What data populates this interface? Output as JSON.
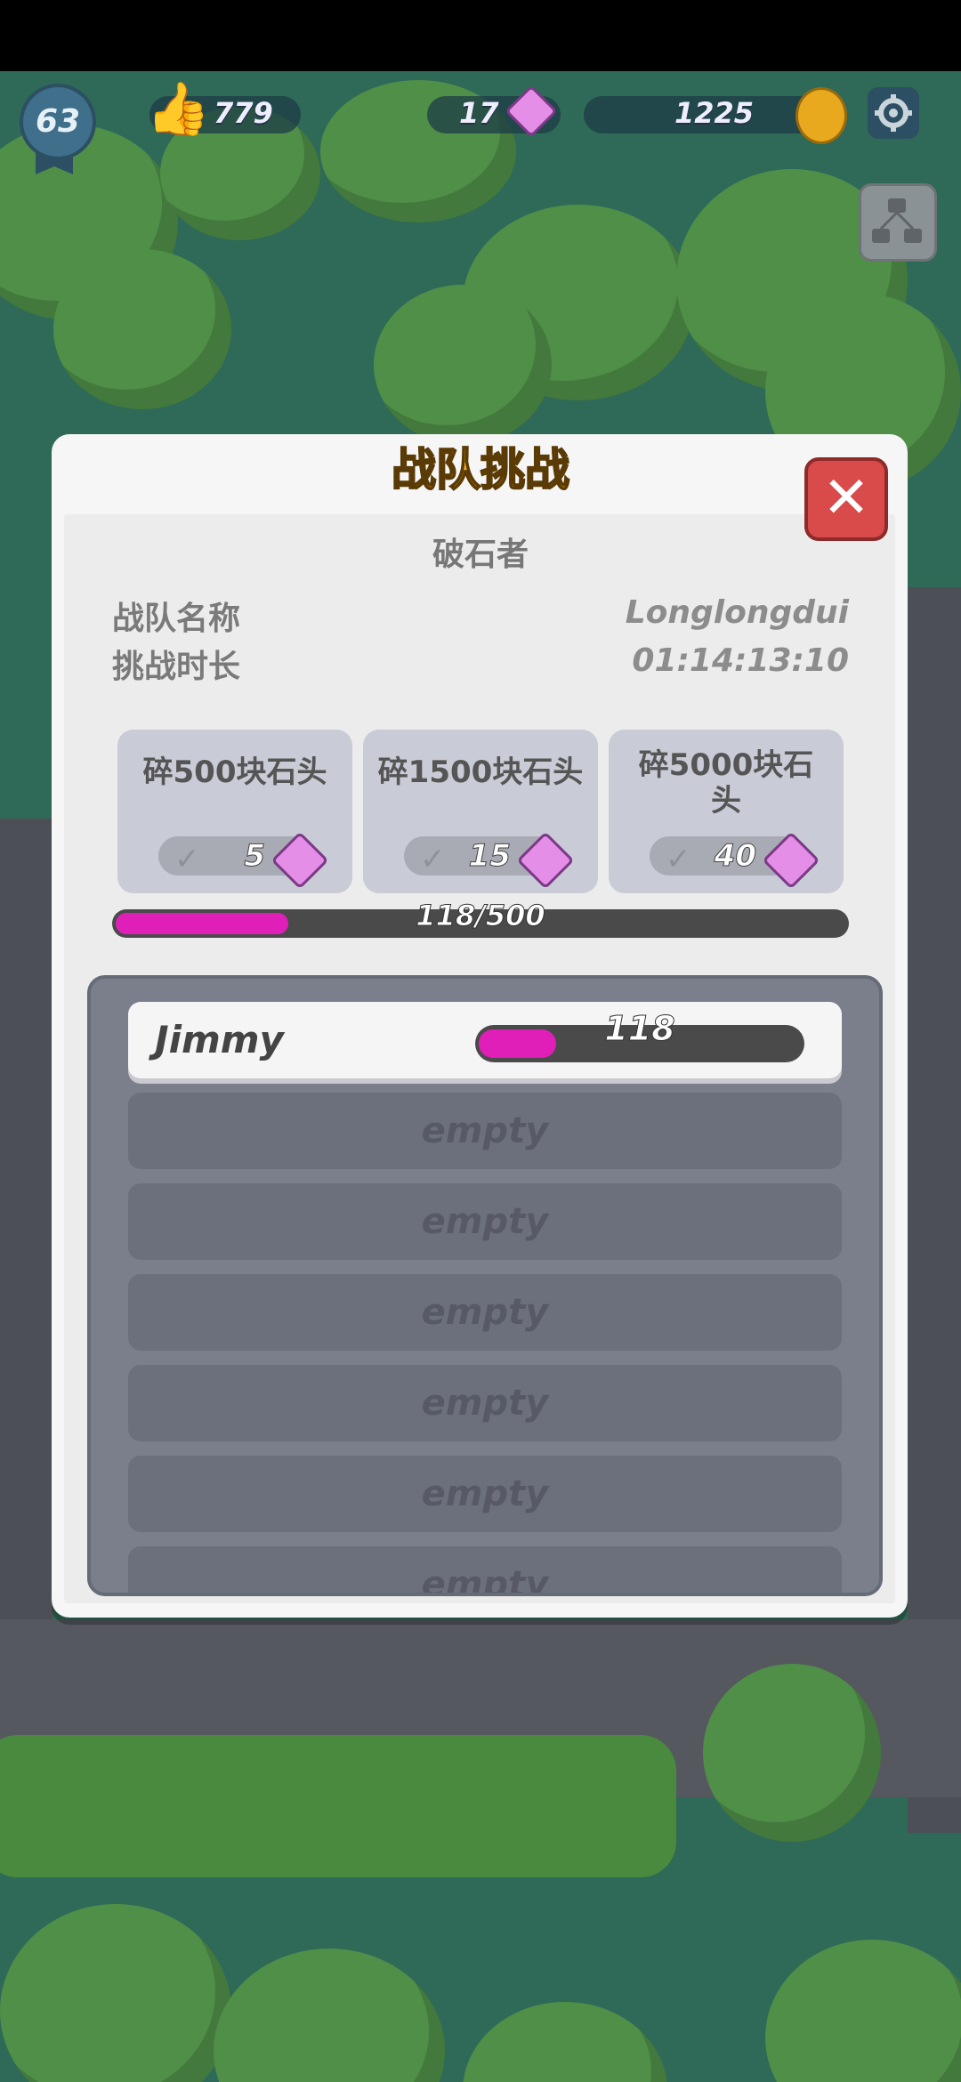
{
  "hud": {
    "level": "63",
    "likes": "779",
    "gems": "17",
    "coins": "1225",
    "icons": [
      "thumbs-up-icon",
      "gem-icon",
      "coin-icon",
      "gear-icon",
      "map-icon"
    ]
  },
  "dialog": {
    "title": "战队挑战",
    "subtitle": "破石者",
    "team_name_label": "战队名称",
    "team_name_value": "Longlongdui",
    "duration_label": "挑战时长",
    "duration_value": "01:14:13:10"
  },
  "tasks": [
    {
      "label": "碎500块石头",
      "reward": "5"
    },
    {
      "label": "碎1500块石头",
      "reward": "15"
    },
    {
      "label": "碎5000块石头",
      "reward": "40"
    }
  ],
  "progress": {
    "text": "118/500",
    "current": 118,
    "max": 500
  },
  "members": {
    "me": {
      "name": "Jimmy",
      "score": "118",
      "fraction": 0.24
    },
    "empty_label": "empty",
    "empty_rows": [
      "empty",
      "empty",
      "empty",
      "empty",
      "empty",
      "empty"
    ]
  },
  "colors": {
    "accent": "#e01fb8",
    "title": "#f7b21f",
    "close": "#d94a4a"
  }
}
